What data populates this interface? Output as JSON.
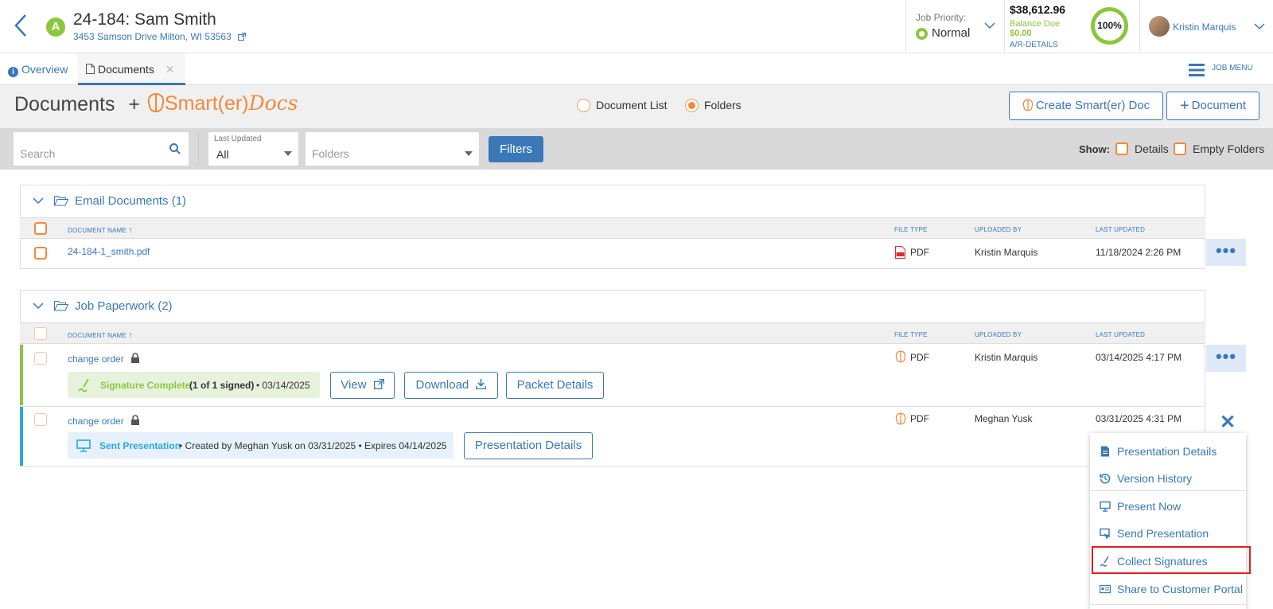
{
  "header": {
    "badge": "A",
    "job_title": "24-184: Sam Smith",
    "address": "3453 Samson Drive Milton, WI 53563",
    "priority_label": "Job Priority:",
    "priority_value": "Normal",
    "balance_amount": "$38,612.96",
    "balance_due_label": "Balance Due",
    "balance_due_value": "$0.00",
    "ar_details": "A/R-DETAILS",
    "progress": "100%",
    "progress_fraction": 1.0,
    "user_name": "Kristin Marquis"
  },
  "tabs": [
    {
      "label": "Overview"
    },
    {
      "label": "Documents"
    }
  ],
  "job_menu": "JOB MENU",
  "title_bar": {
    "title": "Documents",
    "plus": "+",
    "brand_main": "Smart(er)",
    "brand_italic": "Docs",
    "view_options": [
      "Document List",
      "Folders"
    ],
    "selected_view": "Folders",
    "create_button": "Create Smart(er) Doc",
    "document_button": "Document"
  },
  "filters": {
    "search_placeholder": "Search",
    "last_updated_label": "Last Updated",
    "last_updated_value": "All",
    "folders_placeholder": "Folders",
    "filters_button": "Filters",
    "show_label": "Show:",
    "details_label": "Details",
    "empty_folders_label": "Empty Folders"
  },
  "columns": {
    "name": "DOCUMENT NAME",
    "file_type": "FILE TYPE",
    "uploaded_by": "UPLOADED BY",
    "last_updated": "LAST UPDATED"
  },
  "folders": [
    {
      "name": "Email Documents (1)",
      "rows": [
        {
          "name": "24-184-1_smith.pdf",
          "file_type": "PDF",
          "uploaded_by": "Kristin Marquis",
          "last_updated": "11/18/2024 2:26 PM"
        }
      ]
    },
    {
      "name": "Job Paperwork (2)",
      "rows": [
        {
          "name": "change order",
          "file_type": "PDF",
          "uploaded_by": "Kristin Marquis",
          "last_updated": "03/14/2025 4:17 PM",
          "status": "Signature Complete",
          "status_detail": "(1 of 1 signed)",
          "status_date": "• 03/14/2025",
          "buttons": [
            "View",
            "Download",
            "Packet Details"
          ]
        },
        {
          "name": "change order",
          "file_type": "PDF",
          "uploaded_by": "Meghan Yusk",
          "last_updated": "03/31/2025 4:31 PM",
          "status": "Sent Presentation",
          "status_detail": "• Created by Meghan Yusk on 03/31/2025 • Expires 04/14/2025",
          "buttons": [
            "Presentation Details"
          ]
        }
      ]
    }
  ],
  "menu": {
    "items": [
      "Presentation Details",
      "Version History",
      "Present Now",
      "Send Presentation",
      "Collect Signatures",
      "Share to Customer Portal"
    ],
    "highlighted": "Collect Signatures"
  },
  "colors": {
    "accent": "#3a78b8",
    "green": "#8cc63f",
    "orange": "#f08a3c",
    "highlight": "#e02020"
  }
}
